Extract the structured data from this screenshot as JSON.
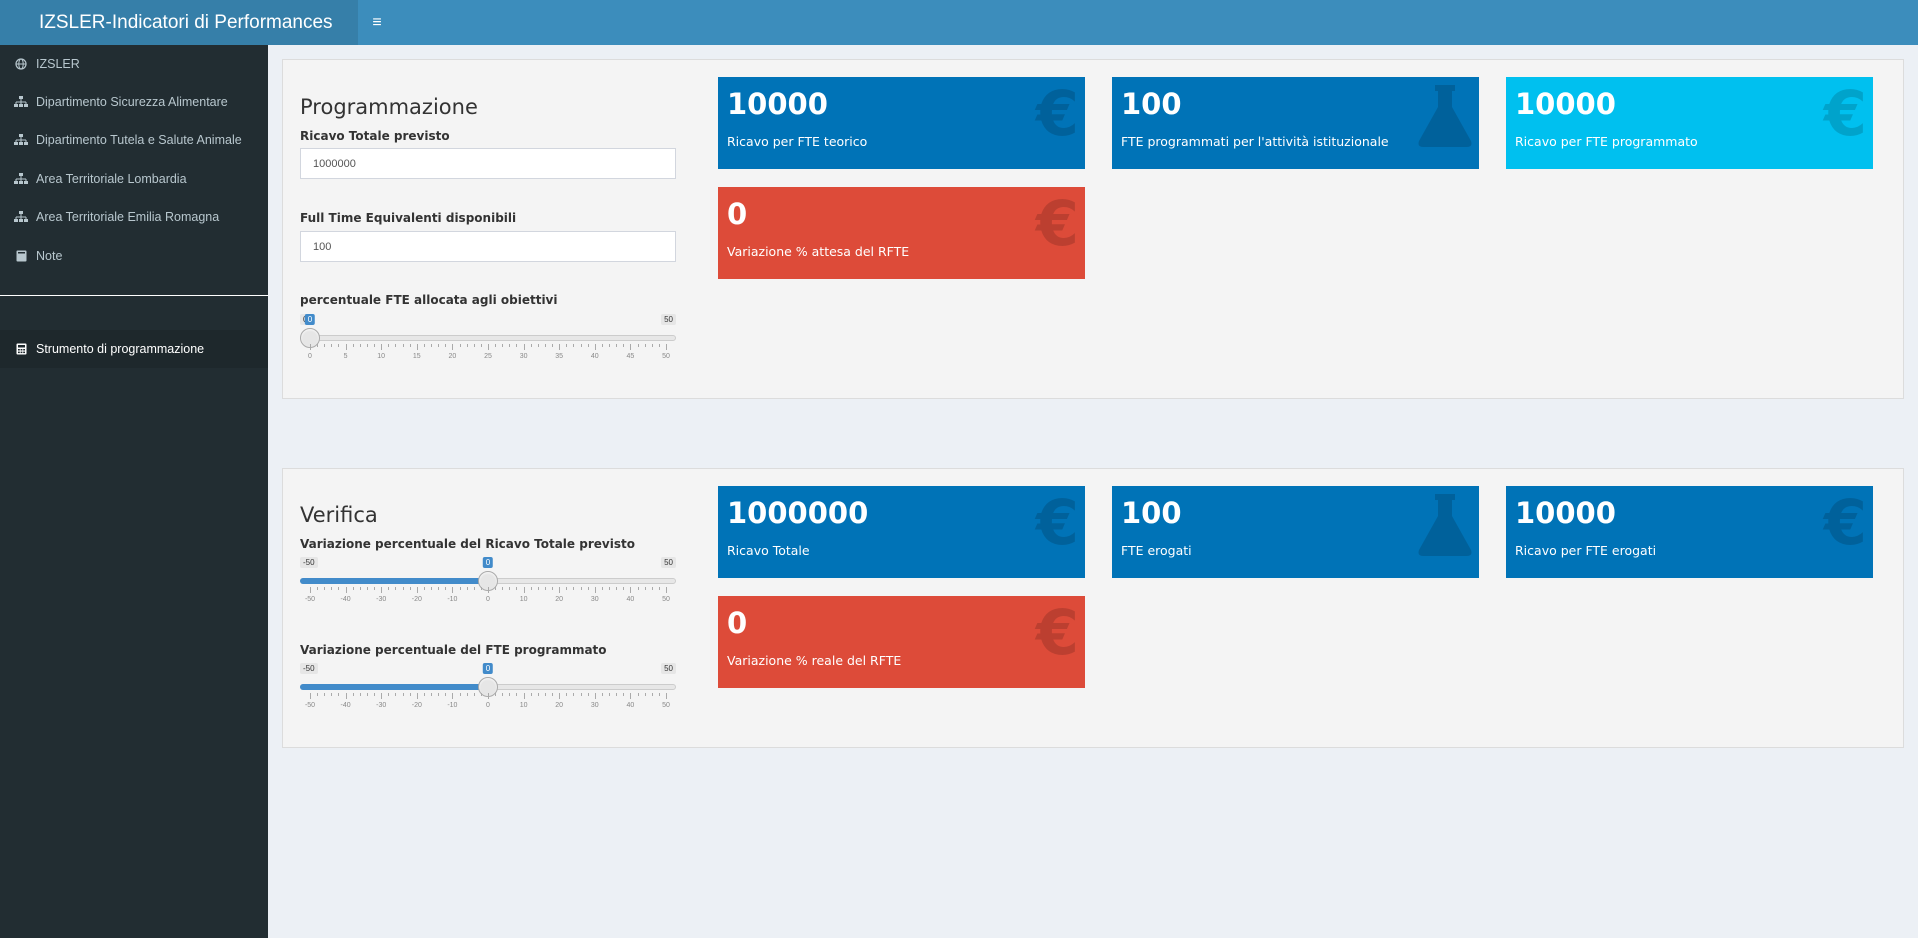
{
  "header": {
    "title": "IZSLER-Indicatori di Performances",
    "menu_icon": "≡"
  },
  "sidebar": {
    "items": [
      {
        "label": "IZSLER",
        "icon": "globe-icon"
      },
      {
        "label": "Dipartimento Sicurezza Alimentare",
        "icon": "sitemap-icon"
      },
      {
        "label": "Dipartimento Tutela e Salute Animale",
        "icon": "sitemap-icon"
      },
      {
        "label": "Area Territoriale Lombardia",
        "icon": "sitemap-icon"
      },
      {
        "label": "Area Territoriale Emilia Romagna",
        "icon": "sitemap-icon"
      },
      {
        "label": "Note",
        "icon": "book-icon"
      }
    ],
    "active_item": {
      "label": "Strumento di programmazione",
      "icon": "calculator-icon"
    }
  },
  "programmazione": {
    "title": "Programmazione",
    "ricavo_label": "Ricavo Totale previsto",
    "ricavo_value": "1000000",
    "fte_label": "Full Time Equivalenti disponibili",
    "fte_value": "100",
    "slider_label": "percentuale FTE allocata agli obiettivi",
    "slider": {
      "min": "0",
      "max": "50",
      "value": "0",
      "ticks": [
        "0",
        "5",
        "10",
        "15",
        "20",
        "25",
        "30",
        "35",
        "40",
        "45",
        "50"
      ]
    },
    "boxes": [
      {
        "value": "10000",
        "text": "Ricavo per FTE teorico",
        "color": "#0073b7",
        "icon": "euro-icon"
      },
      {
        "value": "100",
        "text": "FTE programmati per l'attività istituzionale",
        "color": "#0073b7",
        "icon": "flask-icon"
      },
      {
        "value": "10000",
        "text": "Ricavo per FTE programmato",
        "color": "#00c0ef",
        "icon": "euro-icon"
      },
      {
        "value": "0",
        "text": "Variazione % attesa del RFTE",
        "color": "#dd4b39",
        "icon": "euro-icon"
      }
    ]
  },
  "verifica": {
    "title": "Verifica",
    "slider1_label": "Variazione percentuale del Ricavo Totale previsto",
    "slider1": {
      "min": "-50",
      "max": "50",
      "value": "0",
      "ticks": [
        "-50",
        "-40",
        "-30",
        "-20",
        "-10",
        "0",
        "10",
        "20",
        "30",
        "40",
        "50"
      ]
    },
    "slider2_label": "Variazione percentuale del FTE programmato",
    "slider2": {
      "min": "-50",
      "max": "50",
      "value": "0",
      "ticks": [
        "-50",
        "-40",
        "-30",
        "-20",
        "-10",
        "0",
        "10",
        "20",
        "30",
        "40",
        "50"
      ]
    },
    "boxes": [
      {
        "value": "1000000",
        "text": "Ricavo Totale",
        "color": "#0073b7",
        "icon": "euro-icon"
      },
      {
        "value": "100",
        "text": "FTE erogati",
        "color": "#0073b7",
        "icon": "flask-icon"
      },
      {
        "value": "10000",
        "text": "Ricavo per FTE erogati",
        "color": "#0073b7",
        "icon": "euro-icon"
      },
      {
        "value": "0",
        "text": "Variazione % reale del RFTE",
        "color": "#dd4b39",
        "icon": "euro-icon"
      }
    ]
  },
  "icons": {
    "euro": "€"
  }
}
